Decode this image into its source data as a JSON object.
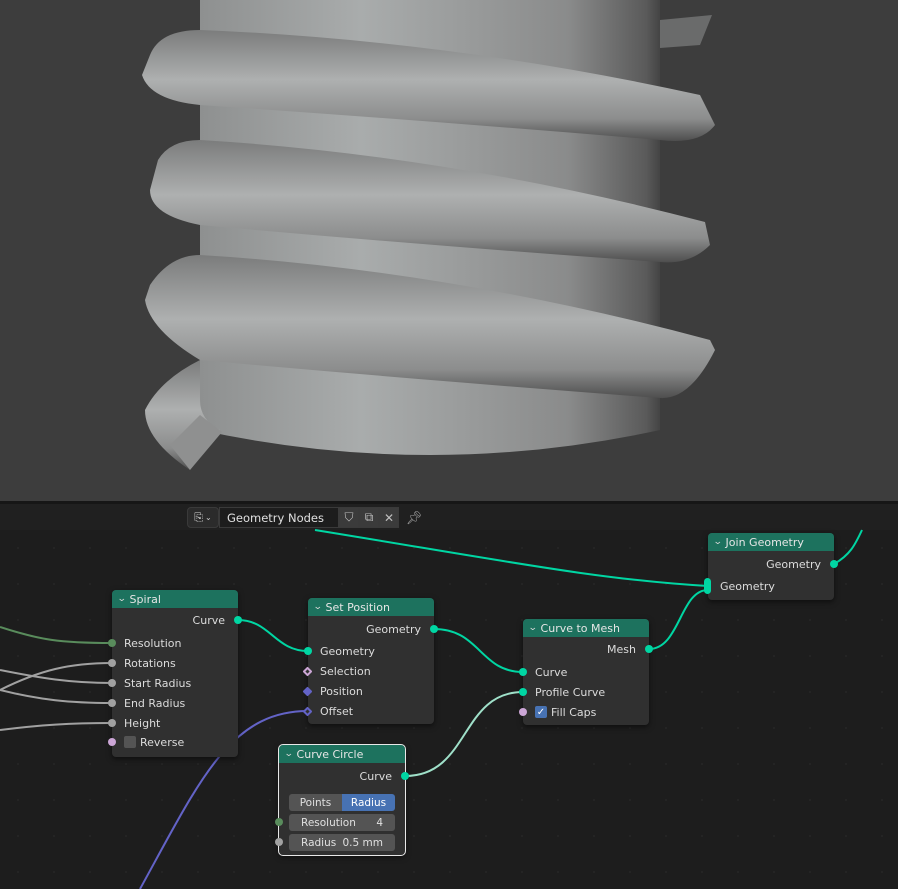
{
  "header": {
    "editor_type_icon": "node-editor-icon",
    "node_tree_name": "Geometry Nodes",
    "fake_user_icon": "shield-icon",
    "duplicate_icon": "duplicate-icon",
    "unlink_icon": "close-icon",
    "pin_icon": "pin-icon"
  },
  "viewport": {
    "description": "3D view of a cylinder with a spiral tube wrapped around it"
  },
  "nodes": {
    "spiral": {
      "title": "Spiral",
      "outputs": [
        "Curve"
      ],
      "inputs": [
        "Resolution",
        "Rotations",
        "Start Radius",
        "End Radius",
        "Height"
      ],
      "reverse_label": "Reverse",
      "reverse_checked": false
    },
    "set_position": {
      "title": "Set Position",
      "outputs": [
        "Geometry"
      ],
      "inputs": [
        "Geometry",
        "Selection",
        "Position",
        "Offset"
      ]
    },
    "curve_to_mesh": {
      "title": "Curve to Mesh",
      "outputs": [
        "Mesh"
      ],
      "inputs": [
        "Curve",
        "Profile Curve"
      ],
      "fill_caps_label": "Fill Caps",
      "fill_caps_checked": true
    },
    "join_geometry": {
      "title": "Join Geometry",
      "outputs": [
        "Geometry"
      ],
      "inputs": [
        "Geometry"
      ]
    },
    "curve_circle": {
      "title": "Curve Circle",
      "outputs": [
        "Curve"
      ],
      "mode_options": [
        "Points",
        "Radius"
      ],
      "mode_selected": "Radius",
      "resolution_label": "Resolution",
      "resolution_value": "4",
      "radius_label": "Radius",
      "radius_value": "0.5 mm"
    }
  },
  "colors": {
    "node_header": "#1d725e",
    "geometry_socket": "#00d6a3",
    "integer_socket": "#598c5c",
    "float_socket": "#a1a1a1",
    "boolean_socket": "#cca6d6",
    "vector_socket": "#6363c7",
    "active_button": "#4772b3"
  }
}
